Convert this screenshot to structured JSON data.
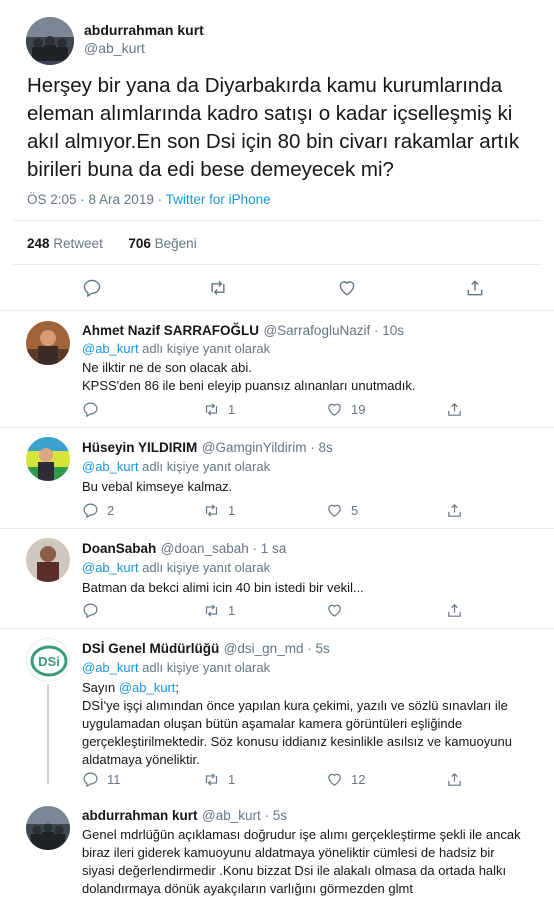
{
  "main_tweet": {
    "author_name": "abdurrahman kurt",
    "handle": "@ab_kurt",
    "text_lines": [
      "Herşey bir yana da Diyarbakırda kamu kurumlarında",
      "eleman alımlarında kadro satışı o kadar içselleşmiş ki",
      "akıl almıyor.En son  Dsi için 80 bin civarı rakamlar artık",
      "birileri buna da edi bese demeyecek mi?"
    ],
    "time": "ÖS 2:05 · 8 Ara 2019 · ",
    "source": "Twitter for iPhone",
    "retweet_count": "248",
    "retweet_label": "Retweet",
    "like_count": "706",
    "like_label": "Beğeni",
    "icons": [
      "reply-icon",
      "retweet-icon",
      "heart-icon",
      "share-icon"
    ]
  },
  "replies": [
    {
      "name": "Ahmet Nazif SARRAFOĞLU",
      "handle_time": "@SarrafogluNazif · 10s",
      "reply_to_handle": "@ab_kurt",
      "reply_to_suffix": " adlı kişiye yanıt olarak",
      "lines": [
        "Ne ilktir ne de son olacak abi.",
        "KPSS'den 86 ile beni eleyip puansız alınanları unutmadık."
      ],
      "reply_count": "",
      "retweet_count": "1",
      "like_count": "19"
    },
    {
      "name": "Hüseyin YILDIRIM",
      "handle_time": "@GamginYildirim · 8s",
      "reply_to_handle": "@ab_kurt",
      "reply_to_suffix": " adlı kişiye yanıt olarak",
      "lines": [
        "Bu vebal kimseye kalmaz."
      ],
      "reply_count": "2",
      "retweet_count": "1",
      "like_count": "5"
    },
    {
      "name": "DoanSabah",
      "handle_time": "@doan_sabah · 1 sa",
      "reply_to_handle": "@ab_kurt",
      "reply_to_suffix": " adlı kişiye yanıt olarak",
      "lines": [
        "Batman da bekci alimi icin 40 bin istedi bir vekil..."
      ],
      "reply_count": "",
      "retweet_count": "1",
      "like_count": ""
    },
    {
      "name": "DSİ Genel Müdürlüğü",
      "handle_time": "@dsi_gn_md · 5s",
      "reply_to_handle": "@ab_kurt",
      "reply_to_suffix": " adlı kişiye yanıt olarak",
      "greeting": "Sayın ",
      "greeting_mention": "@ab_kurt",
      "greeting_end": ";",
      "lines": [
        "DSİ'ye işçi alımından önce yapılan kura çekimi, yazılı ve sözlü sınavları ile",
        "uygulamadan oluşan bütün aşamalar kamera görüntüleri eşliğinde",
        "gerçekleştirilmektedir. Söz konusu iddianız kesinlikle asılsız ve kamuoyunu",
        "aldatmaya yöneliktir."
      ],
      "reply_count": "11",
      "retweet_count": "1",
      "like_count": "12",
      "logo_text": "DSi"
    },
    {
      "name": "abdurrahman kurt",
      "handle_time": "@ab_kurt · 5s",
      "lines": [
        "Genel mdrlüğün açıklaması doğrudur işe alımı gerçekleştirme şekli ile ancak",
        "biraz ileri giderek kamuoyunu aldatmaya yöneliktir cümlesi de hadsiz bir",
        "siyasi değerlendirmedir .Konu bizzat Dsi ile alakalı olmasa da ortada halkı",
        "dolandırmaya dönük ayakçıların varlığını görmezden glmt"
      ]
    }
  ],
  "colors": {
    "link": "#1b95e0",
    "muted": "#657786",
    "divider": "#e6ecf0",
    "dsi_green": "#3a9a7a"
  }
}
